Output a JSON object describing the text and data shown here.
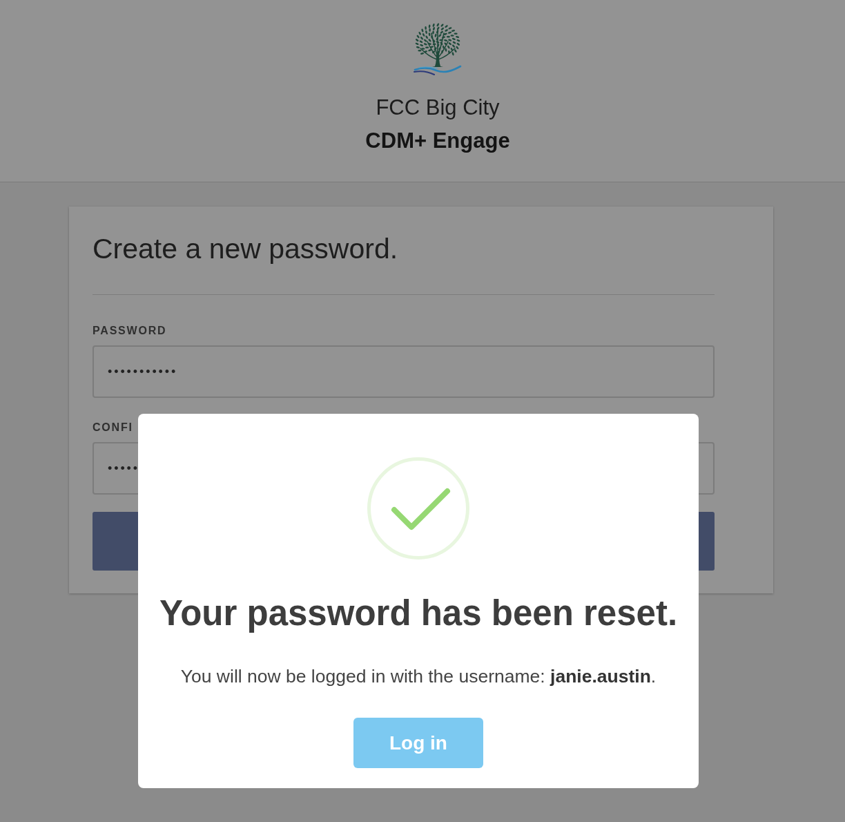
{
  "header": {
    "organization": "FCC Big City",
    "product": "CDM+ Engage"
  },
  "form": {
    "title": "Create a new password.",
    "fields": [
      {
        "label": "PASSWORD",
        "value": "•••••••••••"
      },
      {
        "label": "CONFI",
        "value": "•••••"
      }
    ]
  },
  "dialog": {
    "title": "Your password has been reset.",
    "message": "You will now be logged in with the username: **janie.austin**.",
    "button": "Log in"
  }
}
